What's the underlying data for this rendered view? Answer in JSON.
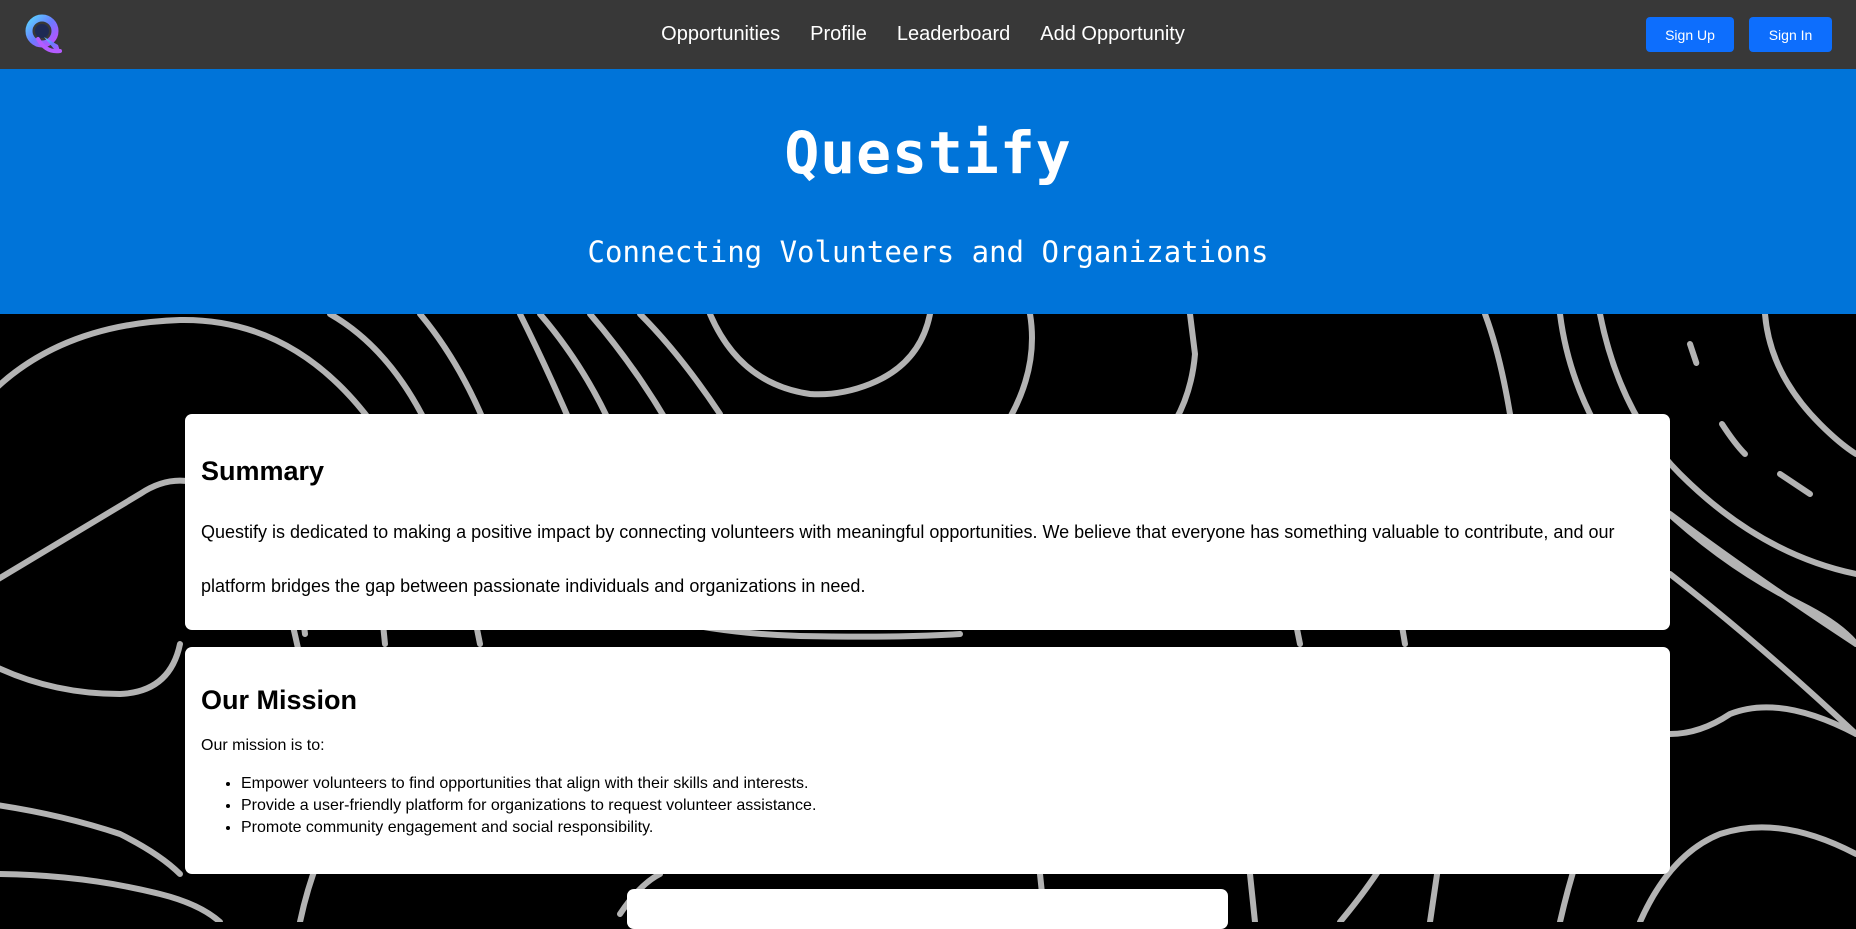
{
  "navbar": {
    "links": [
      {
        "label": "Opportunities"
      },
      {
        "label": "Profile"
      },
      {
        "label": "Leaderboard"
      },
      {
        "label": "Add Opportunity"
      }
    ],
    "sign_up_label": "Sign Up",
    "sign_in_label": "Sign In"
  },
  "hero": {
    "title": "Questify",
    "subtitle": "Connecting Volunteers and Organizations"
  },
  "summary": {
    "title": "Summary",
    "text": "Questify is dedicated to making a positive impact by connecting volunteers with meaningful opportunities. We believe that everyone has something valuable to contribute, and our platform bridges the gap between passionate individuals and organizations in need."
  },
  "mission": {
    "title": "Our Mission",
    "intro": "Our mission is to:",
    "items": [
      {
        "text": "Empower volunteers to find opportunities that align with their skills and interests."
      },
      {
        "text": "Provide a user-friendly platform for organizations to request volunteer assistance."
      },
      {
        "text": "Promote community engagement and social responsibility."
      }
    ]
  },
  "colors": {
    "navbar_bg": "#383838",
    "hero_bg": "#0074d9",
    "button_bg": "#0d6efd",
    "background": "#000000",
    "pattern_stroke": "#b3b3b3",
    "card_bg": "#ffffff"
  },
  "icons": {
    "logo": "questify-q-logo-icon"
  }
}
